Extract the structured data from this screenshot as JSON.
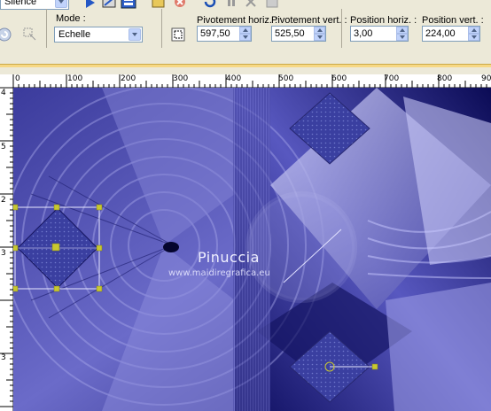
{
  "preset_combo": {
    "value": "Silence"
  },
  "mode": {
    "label": "Mode :",
    "value": "Echelle"
  },
  "fields": [
    {
      "label": "Pivotement horiz. :",
      "value": "597,50"
    },
    {
      "label": "Pivotement vert. :",
      "value": "525,50"
    },
    {
      "label": "Position horiz. :",
      "value": "3,00"
    },
    {
      "label": "Position vert. :",
      "value": "224,00"
    }
  ],
  "ruler": {
    "h_labels": [
      "0",
      "100",
      "200",
      "300",
      "400",
      "500",
      "600",
      "700",
      "800",
      "900"
    ],
    "v_labels": [
      "4",
      "5",
      "2",
      "3",
      "3"
    ]
  },
  "watermark": {
    "title": "Pinuccia",
    "url": "www.maidiregrafica.eu"
  },
  "colors": {
    "toolbar_bg": "#ece9d8",
    "canvas_dark": "#0d0d5e",
    "canvas_light": "#b9b9ef",
    "handle": "#c8c830"
  }
}
